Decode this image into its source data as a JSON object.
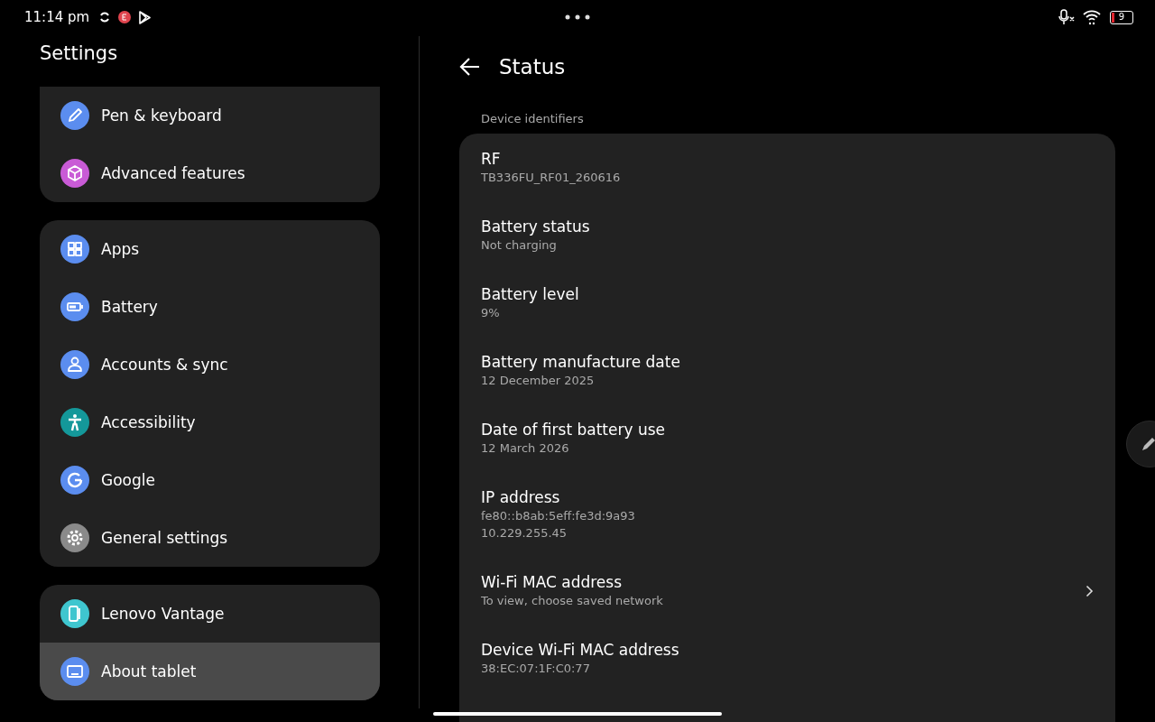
{
  "status_bar": {
    "time": "11:14 pm",
    "battery": "9"
  },
  "sidebar": {
    "title": "Settings",
    "groups": [
      {
        "items": [
          {
            "label": "Pen & keyboard",
            "color": "#5b8def",
            "selected": false
          },
          {
            "label": "Advanced features",
            "color": "#c95bd6",
            "selected": false
          }
        ]
      },
      {
        "items": [
          {
            "label": "Apps",
            "color": "#5b8def",
            "selected": false
          },
          {
            "label": "Battery",
            "color": "#5b8def",
            "selected": false
          },
          {
            "label": "Accounts & sync",
            "color": "#5b8def",
            "selected": false
          },
          {
            "label": "Accessibility",
            "color": "#14989a",
            "selected": false
          },
          {
            "label": "Google",
            "color": "#5b8def",
            "selected": false
          },
          {
            "label": "General settings",
            "color": "#8a8a8a",
            "selected": false
          }
        ]
      },
      {
        "items": [
          {
            "label": "Lenovo Vantage",
            "color": "#3fc6cf",
            "selected": false
          },
          {
            "label": "About tablet",
            "color": "#5b8def",
            "selected": true
          }
        ]
      }
    ]
  },
  "page": {
    "title": "Status",
    "section": "Device identifiers",
    "rows": [
      {
        "kind": "info",
        "title": "RF",
        "lines": [
          "TB336FU_RF01_260616"
        ]
      },
      {
        "kind": "info",
        "title": "Battery status",
        "lines": [
          "Not charging"
        ]
      },
      {
        "kind": "info",
        "title": "Battery level",
        "lines": [
          "9%"
        ]
      },
      {
        "kind": "info",
        "title": "Battery manufacture date",
        "lines": [
          "12 December 2025"
        ]
      },
      {
        "kind": "info",
        "title": "Date of first battery use",
        "lines": [
          "12 March 2026"
        ]
      },
      {
        "kind": "info",
        "title": "IP address",
        "lines": [
          "fe80::b8ab:5eff:fe3d:9a93",
          "10.229.255.45"
        ]
      },
      {
        "kind": "link",
        "title": "Wi-Fi MAC address",
        "lines": [
          "To view, choose saved network"
        ]
      },
      {
        "kind": "info",
        "title": "Device Wi-Fi MAC address",
        "lines": [
          "38:EC:07:1F:C0:77"
        ]
      }
    ]
  }
}
